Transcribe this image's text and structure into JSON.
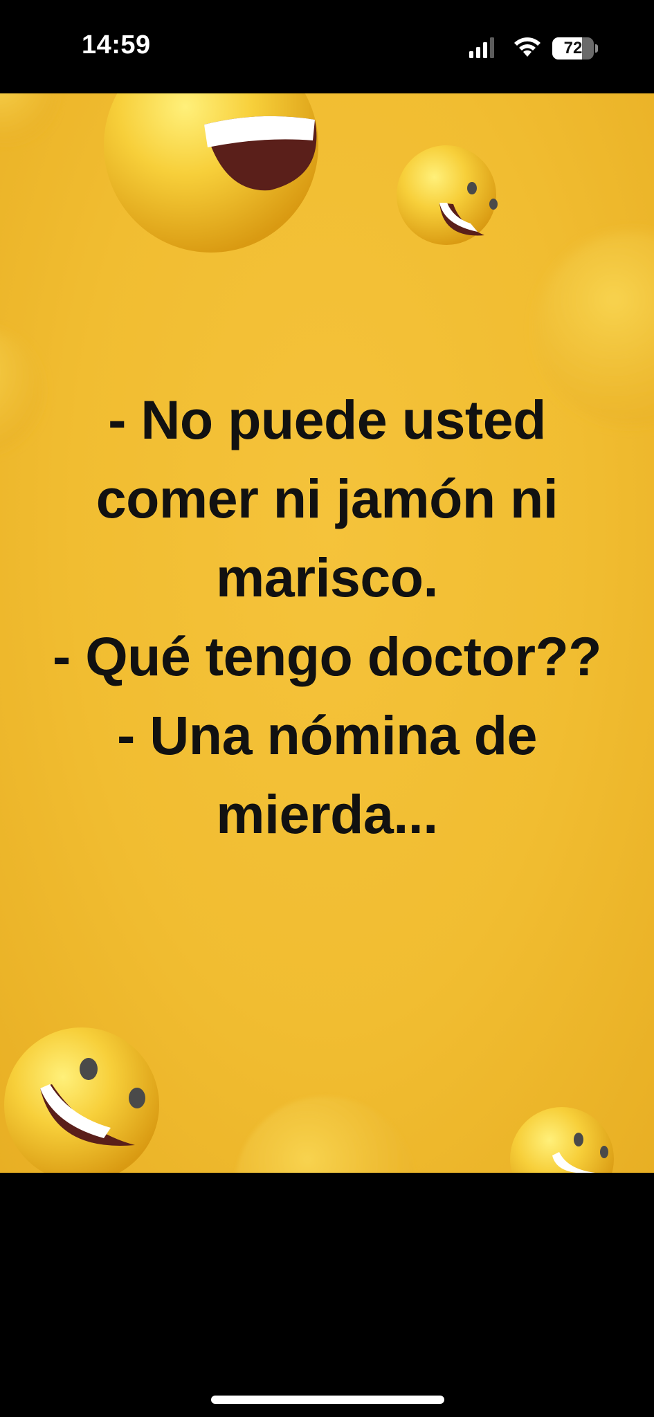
{
  "status_bar": {
    "time": "14:59",
    "signal_icon": "cellular-signal-icon",
    "wifi_icon": "wifi-icon",
    "battery": {
      "label": "72",
      "level_percent": 72
    }
  },
  "photo": {
    "background_color": "#f1bd31",
    "meme_lines": [
      "- No puede usted",
      "comer ni jamón ni",
      "marisco.",
      "- Qué tengo doctor??",
      "- Una nómina de",
      "mierda..."
    ],
    "decorations": [
      "laughing-emoji-icon",
      "smiling-emoji-icon"
    ]
  },
  "system": {
    "home_indicator": "home-indicator"
  }
}
